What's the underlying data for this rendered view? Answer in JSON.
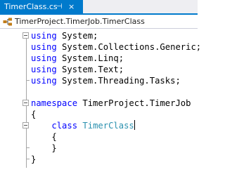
{
  "tab": {
    "title": "TimerClass.cs",
    "pin_glyph": "⊣",
    "close_glyph": "×"
  },
  "navbar": {
    "scope": "TimerProject.TimerJob.TimerClass"
  },
  "code": {
    "kw_using": "using",
    "using_system": " System;",
    "using_collections": " System.Collections.Generic;",
    "using_linq": " System.Linq;",
    "using_text": " System.Text;",
    "using_tasks": " System.Threading.Tasks;",
    "kw_namespace": "namespace",
    "namespace_name": " TimerProject.TimerJob",
    "brace_open": "{",
    "brace_close": "}",
    "class_indent": "    ",
    "kw_class": "class",
    "class_name": "TimerClass",
    "inner_indent": "    "
  },
  "colors": {
    "keyword": "#0000ff",
    "type": "#2b91af",
    "tab_active": "#007acc"
  }
}
